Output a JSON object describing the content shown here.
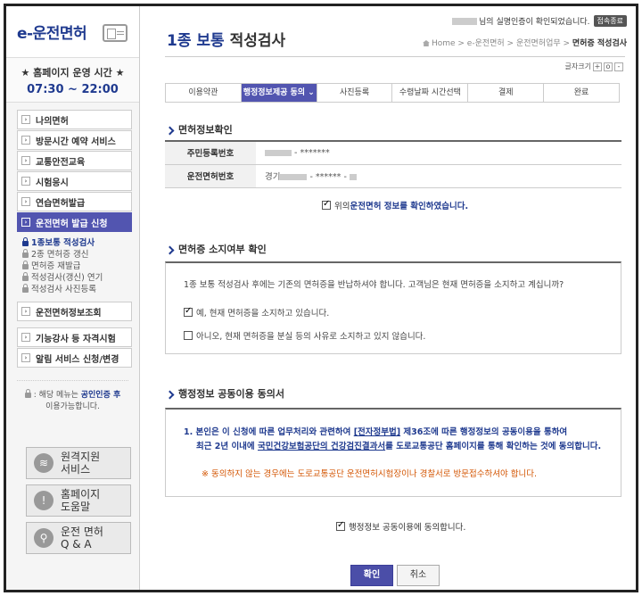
{
  "logo": {
    "text": "e-운전면허",
    "icon": "license-card-icon"
  },
  "hours": {
    "title": "★ 홈페이지 운영 시간 ★",
    "time": "07:30 ~ 22:00"
  },
  "sidebar": {
    "menu_top": [
      {
        "label": "나의면허",
        "name": "my-license"
      },
      {
        "label": "방문시간 예약 서비스",
        "name": "visit-reservation"
      },
      {
        "label": "교통안전교육",
        "name": "traffic-safety-education"
      },
      {
        "label": "시험응시",
        "name": "test-application"
      },
      {
        "label": "연습면허발급",
        "name": "practice-license"
      },
      {
        "label": "운전면허 발급 신청",
        "name": "license-issuance",
        "active": true
      }
    ],
    "submenu": [
      {
        "label": "1종보통 적성검사",
        "active": true
      },
      {
        "label": "2종 면허증 갱신"
      },
      {
        "label": "면허증 재발급"
      },
      {
        "label": "적성검사(갱신) 연기"
      },
      {
        "label": "적성검사 사진등록"
      }
    ],
    "menu_bottom": [
      {
        "label": "운전면허정보조회"
      },
      {
        "label": "기능강사 등 자격시험"
      },
      {
        "label": "알림 서비스 신청/변경"
      }
    ],
    "notice_prefix": ": 해당 메뉴는 ",
    "notice_hl": "공인인증 후",
    "notice_suffix": "이용가능합니다."
  },
  "services": [
    {
      "label1": "원격지원",
      "label2": "서비스",
      "icon": "wifi-icon",
      "glyph": "≋"
    },
    {
      "label1": "홈페이지",
      "label2": "도움말",
      "icon": "alert-icon",
      "glyph": "!"
    },
    {
      "label1": "운전 면허",
      "label2": "Q & A",
      "icon": "search-icon",
      "glyph": "⚲"
    }
  ],
  "header": {
    "user_suffix": "님의 실명인증이 확인되었습니다.",
    "logout": "접속종료",
    "title_hl": "1종 보통",
    "title_rest": "적성검사",
    "breadcrumb": [
      "Home",
      "e-운전면허",
      "운전면허업무",
      "면허증 적성검사"
    ],
    "font_size_label": "글자크기",
    "font_buttons": [
      "+",
      "o",
      "-"
    ]
  },
  "steps": [
    {
      "label": "이용약관"
    },
    {
      "label": "행정정보제공 동의 ⌄",
      "active": true
    },
    {
      "label": "사진등록"
    },
    {
      "label": "수령날짜 시간선택"
    },
    {
      "label": "결제"
    },
    {
      "label": "완료"
    }
  ],
  "section1": {
    "title": "면허정보확인",
    "rows": [
      {
        "label": "주민등록번호",
        "value": "- *******"
      },
      {
        "label": "운전면허번호",
        "prefix": "경기",
        "value": "- ****** -"
      }
    ],
    "confirm_prefix": "위의 ",
    "confirm_hl": "운전면허 정보",
    "confirm_suffix": "를 확인하였습니다."
  },
  "section2": {
    "title": "면허증 소지여부 확인",
    "question": "1종 보통 적성검사 후에는 기존의 면허증을 반납하셔야 합니다. 고객님은 현재 면허증을 소지하고 계십니까?",
    "option_yes": "예, 현재 면허증을 소지하고 있습니다.",
    "option_no": "아니오, 현재 면허증을 분실 등의 사유로 소지하고 있지 않습니다."
  },
  "section3": {
    "title": "행정정보 공동이용 동의서",
    "line1_a": "1. 본인은 이 신청에 따른 업무처리와 관련하여 ",
    "line1_b": "[전자정부법]",
    "line1_c": " 제36조에 따른 행정정보의 공동이용을 통하여",
    "line2_a": "최근 2년 이내에 ",
    "line2_b": "국민건강보험공단의 건강검진결과서",
    "line2_c": "를 도로교통공단 홈페이지를 통해 확인하는 것에 동의합니다.",
    "warning": "※ 동의하지 않는 경우에는 도로교통공단 운전면허시험장이나 경찰서로 방문접수하셔야 합니다.",
    "agree": "행정정보 공동이용에 동의합니다."
  },
  "buttons": {
    "confirm": "확인",
    "cancel": "취소"
  }
}
